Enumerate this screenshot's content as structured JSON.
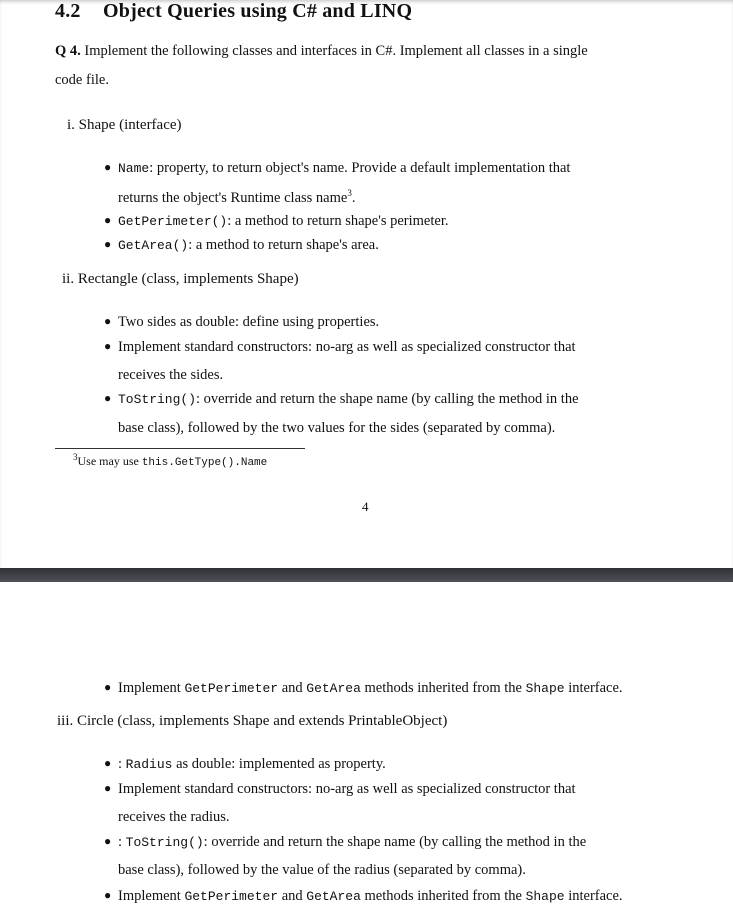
{
  "page1": {
    "section_number": "4.2",
    "section_title": "Object Queries using C# and LINQ",
    "question_label": "Q 4.",
    "question_line1": "Implement the following classes and interfaces in C#. Implement all classes in a single",
    "question_line2": "code file.",
    "item_i": "i. Shape (interface)",
    "shape_bullets": [
      {
        "code": "Name",
        "text": ": property, to return object's name.  Provide a default implementation that",
        "cont": "returns the object's Runtime class name",
        "sup": "3",
        "cont_end": "."
      },
      {
        "code": "GetPerimeter()",
        "text": ": a method to return shape's perimeter."
      },
      {
        "code": "GetArea()",
        "text": ": a method to return shape's area."
      }
    ],
    "item_ii": "ii. Rectangle (class, implements Shape)",
    "rect_bullets": [
      {
        "text": "Two sides as double: define using properties."
      },
      {
        "text": "Implement standard constructors: no-arg as well as specialized constructor that",
        "cont": "receives the sides."
      },
      {
        "code": "ToString()",
        "text": ": override and return the shape name (by calling the method in the",
        "cont": "base class), followed by the two values for the sides (separated by comma)."
      }
    ],
    "footnote_mark": "3",
    "footnote_text": "Use may use ",
    "footnote_code": "this.GetType().Name",
    "page_number": "4"
  },
  "page2": {
    "bullet_impl": {
      "pre": "Implement ",
      "code1": "GetPerimeter",
      "mid": " and ",
      "code2": "GetArea",
      "post": " methods inherited from the ",
      "code3": "Shape",
      "end": " interface."
    },
    "item_iii": "iii. Circle (class, implements Shape and extends PrintableObject)",
    "circle_bullets": [
      {
        "pre": ": ",
        "code": "Radius",
        "text": " as double: implemented as property."
      },
      {
        "text": "Implement standard constructors: no-arg as well as specialized constructor that",
        "cont": "receives the radius."
      },
      {
        "pre": ": ",
        "code": "ToString()",
        "text": ": override and return the shape name (by calling the method in the",
        "cont": "base class), followed by the value of the radius (separated by comma)."
      }
    ],
    "bullet_impl2": {
      "pre": "Implement ",
      "code1": "GetPerimeter",
      "mid": " and ",
      "code2": "GetArea",
      "post": " methods inherited from the ",
      "code3": "Shape",
      "end": " interface."
    }
  }
}
